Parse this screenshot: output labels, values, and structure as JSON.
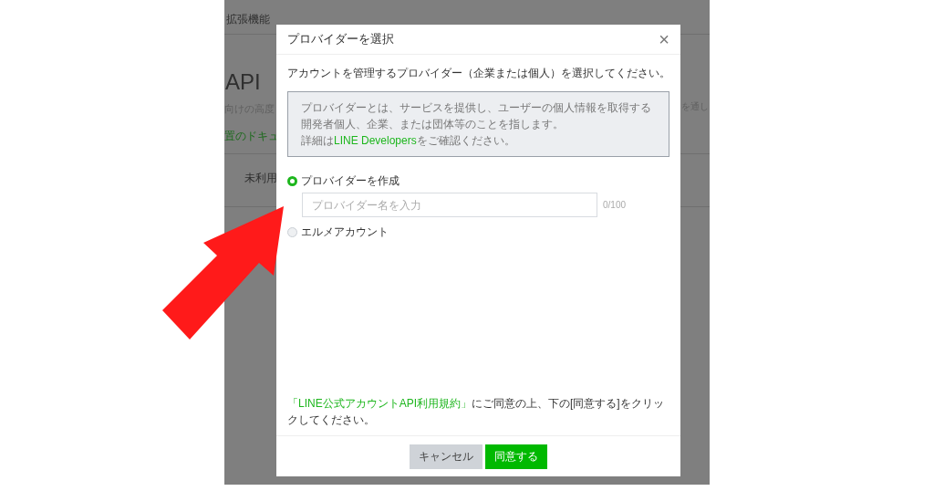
{
  "background_page": {
    "tab": "拡張機能",
    "heading": "API",
    "description_left": "向けの高度",
    "description_right": "を通し",
    "doc_link": "置のドキュ",
    "row_label": "未利用"
  },
  "dialog": {
    "title": "プロバイダーを選択",
    "close": "×",
    "intro": "アカウントを管理するプロバイダー（企業または個人）を選択してください。",
    "info": {
      "lines": [
        "プロバイダーとは、サービスを提供し、ユーザーの個人情報を取得する開発者個人、企業、または団体等のことを指します。"
      ],
      "detail_before": "詳細は",
      "detail_link": "LINE Developers",
      "detail_after": "をご確認ください。"
    },
    "options": [
      {
        "label": "プロバイダーを作成",
        "selected": true,
        "input": {
          "placeholder": "プロバイダー名を入力",
          "counter": "0/100"
        }
      },
      {
        "label": "エルメアカウント",
        "selected": false
      }
    ],
    "terms": {
      "link": "「LINE公式アカウントAPI利用規約」",
      "text": "にご同意の上、下の[同意する]をクリックしてください。"
    },
    "buttons": [
      {
        "label": "キャンセル",
        "kind": "secondary"
      },
      {
        "label": "同意する",
        "kind": "primary"
      }
    ]
  }
}
